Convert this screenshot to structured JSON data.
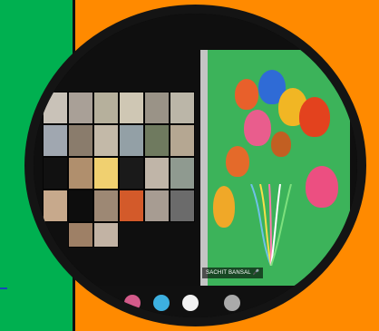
{
  "share": {
    "presenter_name": "SACHIT BANSAL",
    "presenter_status": "🎤"
  },
  "colors": {
    "left_panel": "#00b050",
    "background": "#ff8a00",
    "frame": "#141414"
  }
}
